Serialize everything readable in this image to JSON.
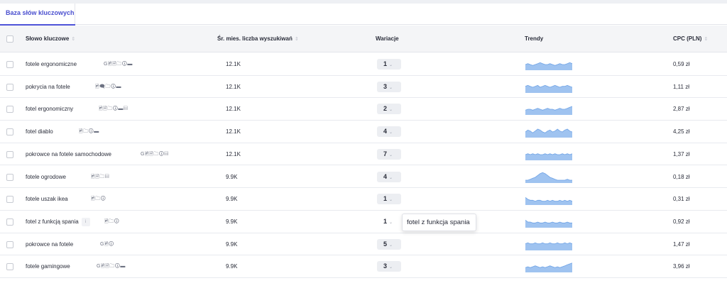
{
  "tabs": {
    "active_label": "Baza słów kluczowych"
  },
  "columns": {
    "keyword": "Słowo kluczowe",
    "volume": "Śr. mies. liczba wyszukiwań",
    "variations": "Wariacje",
    "trends": "Trendy",
    "cpc": "CPC (PLN)"
  },
  "sort_glyph": "⇕",
  "chevron_glyph": "⌄",
  "accent_color": "#4f54d9",
  "sparkline_color": "#9fc3f0",
  "rows": [
    {
      "keyword": "fotele ergonomiczne",
      "icons": "G🖻🗎🗀🛈▬",
      "volume": "12.1K",
      "variations": "1",
      "cpc": "0,59 zł",
      "trend": [
        6,
        7,
        6,
        5,
        6,
        7,
        8,
        7,
        6,
        6,
        7,
        6,
        5,
        6,
        7,
        6,
        6,
        7,
        8,
        7
      ]
    },
    {
      "keyword": "pokrycia na fotele",
      "icons": "🖻🗨🗀🛈▬",
      "volume": "12.1K",
      "variations": "3",
      "cpc": "1,11 zł",
      "trend": [
        7,
        8,
        7,
        6,
        7,
        8,
        6,
        7,
        8,
        7,
        6,
        7,
        8,
        7,
        6,
        7,
        7,
        8,
        7,
        6
      ]
    },
    {
      "keyword": "fotel ergonomiczny",
      "icons": "🖻🗎🗀🛈▬▤",
      "volume": "12.1K",
      "variations": "2",
      "cpc": "2,87 zł",
      "trend": [
        5,
        6,
        6,
        5,
        6,
        7,
        6,
        5,
        6,
        7,
        6,
        6,
        5,
        6,
        7,
        6,
        6,
        7,
        8,
        9
      ]
    },
    {
      "keyword": "fotel diablo",
      "icons": "🖻🗀🛈▬",
      "volume": "12.1K",
      "variations": "4",
      "cpc": "4,25 zł",
      "trend": [
        6,
        8,
        7,
        5,
        7,
        9,
        8,
        6,
        5,
        7,
        8,
        6,
        7,
        9,
        7,
        6,
        8,
        9,
        7,
        6
      ]
    },
    {
      "keyword": "pokrowce na fotele samochodowe",
      "icons": "G🖻🗎🗀🛈▤",
      "volume": "12.1K",
      "variations": "7",
      "cpc": "1,37 zł",
      "trend": [
        6,
        7,
        6,
        7,
        6,
        7,
        6,
        6,
        7,
        6,
        7,
        6,
        7,
        6,
        6,
        7,
        6,
        7,
        6,
        7
      ]
    },
    {
      "keyword": "fotele ogrodowe",
      "icons": "🖻🗎🗀▤",
      "volume": "9.9K",
      "variations": "4",
      "cpc": "0,18 zł",
      "trend": [
        3,
        3,
        4,
        5,
        6,
        8,
        10,
        11,
        10,
        8,
        6,
        5,
        4,
        3,
        3,
        3,
        3,
        4,
        3,
        3
      ]
    },
    {
      "keyword": "fotele uszak ikea",
      "icons": "🖻🗀🛈",
      "volume": "9.9K",
      "variations": "1",
      "cpc": "0,31 zł",
      "trend": [
        8,
        6,
        5,
        5,
        4,
        5,
        5,
        4,
        4,
        5,
        4,
        5,
        4,
        4,
        5,
        4,
        5,
        4,
        5,
        4
      ]
    },
    {
      "keyword": "fotel z funkcją spania",
      "icons": "🖻🗀🛈",
      "volume": "9.9K",
      "variations": "1",
      "cpc": "0,92 zł",
      "trend": [
        8,
        6,
        6,
        5,
        5,
        6,
        5,
        5,
        6,
        5,
        5,
        6,
        5,
        5,
        6,
        5,
        5,
        6,
        5,
        5
      ],
      "badge": "i"
    },
    {
      "keyword": "pokrowce na fotele",
      "icons": "G🖻🛈",
      "volume": "9.9K",
      "variations": "5",
      "cpc": "1,47 zł",
      "trend": [
        7,
        8,
        7,
        7,
        8,
        7,
        7,
        8,
        7,
        7,
        8,
        7,
        7,
        8,
        7,
        7,
        8,
        7,
        8,
        7
      ]
    },
    {
      "keyword": "fotele gamingowe",
      "icons": "G🖻🗎🗀🛈▬",
      "volume": "9.9K",
      "variations": "3",
      "cpc": "3,96 zł",
      "trend": [
        5,
        6,
        5,
        6,
        7,
        6,
        5,
        6,
        5,
        6,
        7,
        6,
        5,
        6,
        5,
        6,
        7,
        8,
        9,
        10
      ]
    }
  ],
  "tooltip": {
    "text": "fotel z funkcja spania"
  }
}
